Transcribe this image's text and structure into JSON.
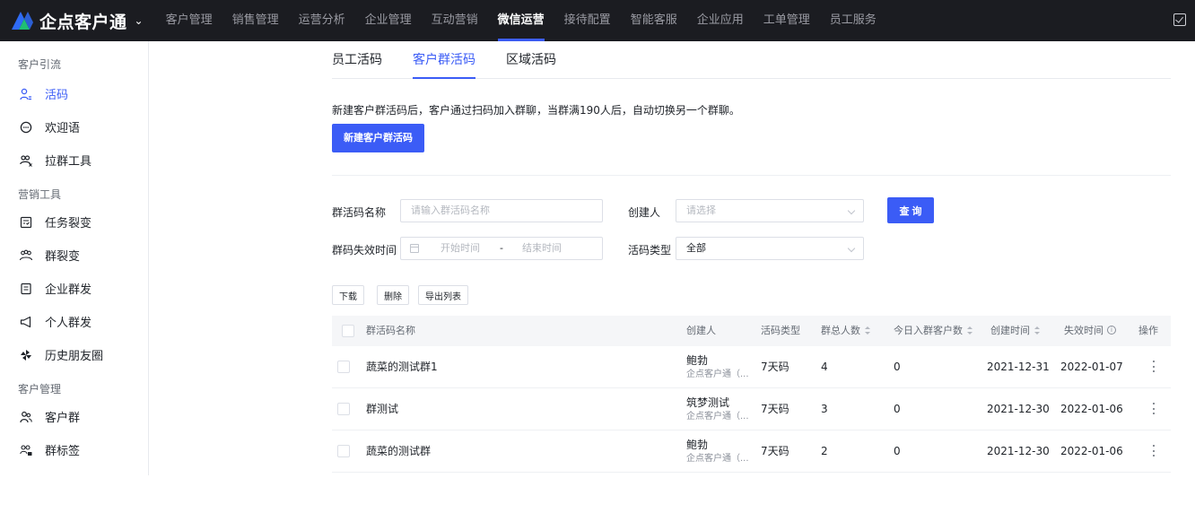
{
  "brand": {
    "name": "企点客户通",
    "logo_icon": "brand-logo-icon"
  },
  "topnav": [
    {
      "label": "客户管理",
      "active": false
    },
    {
      "label": "销售管理",
      "active": false
    },
    {
      "label": "运营分析",
      "active": false
    },
    {
      "label": "企业管理",
      "active": false
    },
    {
      "label": "互动营销",
      "active": false
    },
    {
      "label": "微信运营",
      "active": true
    },
    {
      "label": "接待配置",
      "active": false
    },
    {
      "label": "智能客服",
      "active": false
    },
    {
      "label": "企业应用",
      "active": false
    },
    {
      "label": "工单管理",
      "active": false
    },
    {
      "label": "员工服务",
      "active": false
    }
  ],
  "sidebar": {
    "groups": [
      {
        "title": "客户引流",
        "items": [
          {
            "label": "活码",
            "icon": "user-code-icon",
            "active": true
          },
          {
            "label": "欢迎语",
            "icon": "chat-bubble-icon",
            "active": false
          },
          {
            "label": "拉群工具",
            "icon": "group-pull-icon",
            "active": false
          }
        ]
      },
      {
        "title": "营销工具",
        "items": [
          {
            "label": "任务裂变",
            "icon": "task-icon",
            "active": false
          },
          {
            "label": "群裂变",
            "icon": "group-fission-icon",
            "active": false
          },
          {
            "label": "企业群发",
            "icon": "document-icon",
            "active": false
          },
          {
            "label": "个人群发",
            "icon": "megaphone-icon",
            "active": false
          },
          {
            "label": "历史朋友圈",
            "icon": "pinwheel-icon",
            "active": false
          }
        ]
      },
      {
        "title": "客户管理",
        "items": [
          {
            "label": "客户群",
            "icon": "customer-group-icon",
            "active": false
          },
          {
            "label": "群标签",
            "icon": "group-tag-icon",
            "active": false
          }
        ]
      }
    ]
  },
  "tabs": [
    {
      "label": "员工活码",
      "active": false
    },
    {
      "label": "客户群活码",
      "active": true
    },
    {
      "label": "区域活码",
      "active": false
    }
  ],
  "description": "新建客户群活码后，客户通过扫码加入群聊，当群满190人后，自动切换另一个群聊。",
  "new_button": "新建客户群活码",
  "filters": {
    "name_label": "群活码名称",
    "name_placeholder": "请输入群活码名称",
    "creator_label": "创建人",
    "creator_placeholder": "请选择",
    "query_button": "查 询",
    "expire_label": "群码失效时间",
    "start_placeholder": "开始时间",
    "range_sep": "-",
    "end_placeholder": "结束时间",
    "type_label": "活码类型",
    "type_value": "全部"
  },
  "actions": {
    "download": "下载",
    "delete": "删除",
    "export": "导出列表"
  },
  "table": {
    "columns": {
      "name": "群活码名称",
      "creator": "创建人",
      "type": "活码类型",
      "total": "群总人数",
      "today": "今日入群客户数",
      "created": "创建时间",
      "expire": "失效时间",
      "ops": "操作"
    },
    "rows": [
      {
        "name": "蔬菜的测试群1",
        "creator": "鲍勃",
        "org": "企点客户通（...",
        "type": "7天码",
        "total": "4",
        "today": "0",
        "created": "2021-12-31",
        "expire": "2022-01-07"
      },
      {
        "name": "群测试",
        "creator": "筑梦测试",
        "org": "企点客户通（...",
        "type": "7天码",
        "total": "3",
        "today": "0",
        "created": "2021-12-30",
        "expire": "2022-01-06"
      },
      {
        "name": "蔬菜的测试群",
        "creator": "鲍勃",
        "org": "企点客户通（...",
        "type": "7天码",
        "total": "2",
        "today": "0",
        "created": "2021-12-30",
        "expire": "2022-01-06"
      }
    ]
  }
}
